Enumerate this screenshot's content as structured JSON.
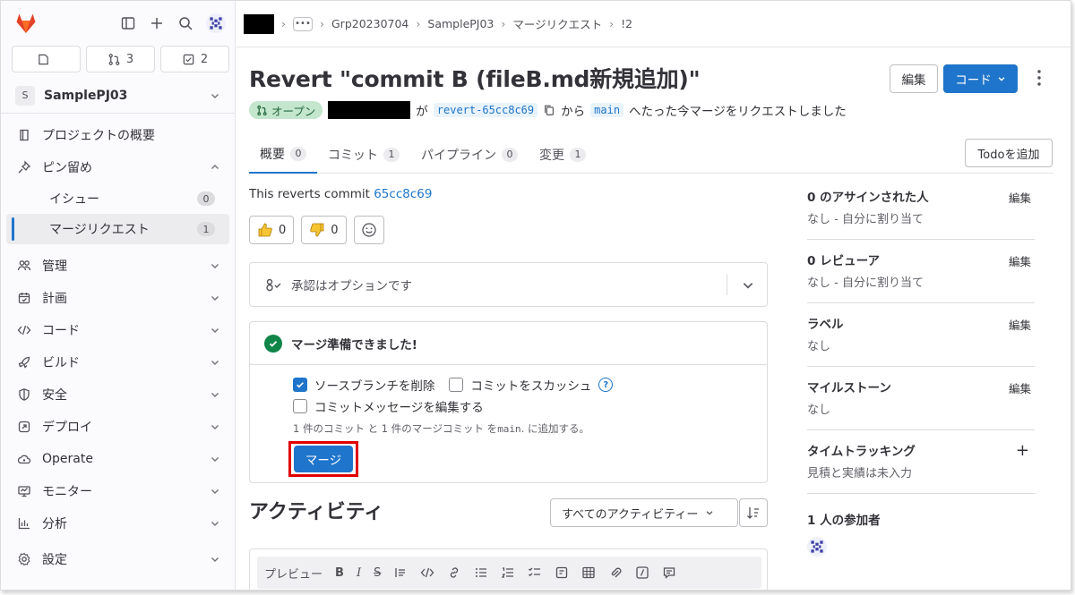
{
  "colors": {
    "accent": "#1f75cb",
    "success": "#108548",
    "highlight_box": "#e00000",
    "open_badge_bg": "#c3e6cd"
  },
  "sidebar": {
    "counts": [
      {
        "icon": "issues-icon",
        "value": ""
      },
      {
        "icon": "merge-request-icon",
        "value": "3"
      },
      {
        "icon": "todo-icon",
        "value": "2"
      }
    ],
    "project": {
      "avatar_letter": "S",
      "name": "SamplePJ03"
    },
    "items": [
      {
        "label": "プロジェクトの概要",
        "icon": "project-icon"
      },
      {
        "label": "ピン留め",
        "icon": "pin-icon"
      },
      {
        "label": "管理",
        "icon": "users-icon"
      },
      {
        "label": "計画",
        "icon": "calendar-icon"
      },
      {
        "label": "コード",
        "icon": "code-icon"
      },
      {
        "label": "ビルド",
        "icon": "rocket-icon"
      },
      {
        "label": "安全",
        "icon": "shield-icon"
      },
      {
        "label": "デプロイ",
        "icon": "deploy-icon"
      },
      {
        "label": "Operate",
        "icon": "cloud-icon"
      },
      {
        "label": "モニター",
        "icon": "monitor-icon"
      },
      {
        "label": "分析",
        "icon": "chart-icon"
      },
      {
        "label": "設定",
        "icon": "gear-icon"
      }
    ],
    "pinned": [
      {
        "label": "イシュー",
        "count": "0"
      },
      {
        "label": "マージリクエスト",
        "count": "1"
      }
    ]
  },
  "breadcrumb": {
    "more": "•••",
    "group": "Grp20230704",
    "project": "SamplePJ03",
    "section": "マージリクエスト",
    "current": "!2"
  },
  "mr": {
    "title": "Revert \"commit B (fileB.md新規追加)\"",
    "edit_label": "編集",
    "code_label": "コード",
    "status": "オープン",
    "meta_ga": "が",
    "source_branch": "revert-65cc8c69",
    "meta_from": "から",
    "target_branch": "main",
    "meta_tail": "へたった今マージをリクエストしました"
  },
  "tabs": [
    {
      "label": "概要",
      "count": "0"
    },
    {
      "label": "コミット",
      "count": "1"
    },
    {
      "label": "パイプライン",
      "count": "0"
    },
    {
      "label": "変更",
      "count": "1"
    }
  ],
  "todo_label": "Todoを追加",
  "description": {
    "prefix": "This reverts commit ",
    "commit": "65cc8c69"
  },
  "reactions": {
    "thumbs_up": "0",
    "thumbs_down": "0"
  },
  "approval": {
    "text": "承認はオプションです"
  },
  "merge": {
    "ready_text": "マージ準備できました!",
    "delete_source": "ソースブランチを削除",
    "squash": "コミットをスカッシュ",
    "edit_message": "コミットメッセージを編集する",
    "note_prefix": "1 件のコミット と 1 件のマージコミット を ",
    "note_branch": "main",
    "note_suffix": ". に追加する。",
    "button": "マージ"
  },
  "activity": {
    "title": "アクティビティ",
    "filter": "すべてのアクティビティー"
  },
  "editor": {
    "preview": "プレビュー"
  },
  "right_sidebar": {
    "assignee_label": "0 のアサインされた人",
    "assignee_value": "なし - 自分に割り当て",
    "reviewer_label": "0 レビューア",
    "reviewer_value": "なし - 自分に割り当て",
    "labels_label": "ラベル",
    "labels_value": "なし",
    "milestone_label": "マイルストーン",
    "milestone_value": "なし",
    "time_label": "タイムトラッキング",
    "time_value": "見積と実績は未入力",
    "participants_label": "1 人の参加者",
    "edit": "編集",
    "plus": "+"
  }
}
